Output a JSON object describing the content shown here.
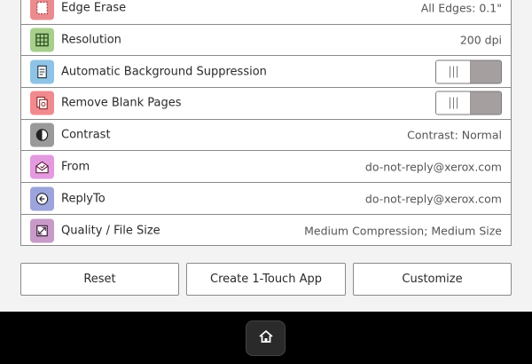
{
  "settings": [
    {
      "label": "Edge Erase",
      "value": "All Edges: 0.1\"",
      "icon": "edge-erase-icon",
      "icon_bg": "#ea8b90"
    },
    {
      "label": "Resolution",
      "value": "200 dpi",
      "icon": "resolution-grid-icon",
      "icon_bg": "#a7cf8c"
    },
    {
      "label": "Automatic Background Suppression",
      "value": "",
      "icon": "background-suppression-icon",
      "icon_bg": "#8ec3e6",
      "toggle": true,
      "toggle_on": false
    },
    {
      "label": "Remove Blank Pages",
      "value": "",
      "icon": "remove-blank-pages-icon",
      "icon_bg": "#f08a8e",
      "toggle": true,
      "toggle_on": false
    },
    {
      "label": "Contrast",
      "value": "Contrast: Normal",
      "icon": "contrast-icon",
      "icon_bg": "#9a9a9a"
    },
    {
      "label": "From",
      "value": "do-not-reply@xerox.com",
      "icon": "envelope-from-icon",
      "icon_bg": "#e39adf"
    },
    {
      "label": "ReplyTo",
      "value": "do-not-reply@xerox.com",
      "icon": "reply-icon",
      "icon_bg": "#9ca4dc"
    },
    {
      "label": "Quality / File Size",
      "value": "Medium Compression; Medium Size",
      "icon": "quality-file-size-icon",
      "icon_bg": "#c79ac7"
    }
  ],
  "buttons": {
    "reset": "Reset",
    "create_app": "Create 1-Touch App",
    "customize": "Customize"
  },
  "nav": {
    "home_icon": "home-icon"
  }
}
